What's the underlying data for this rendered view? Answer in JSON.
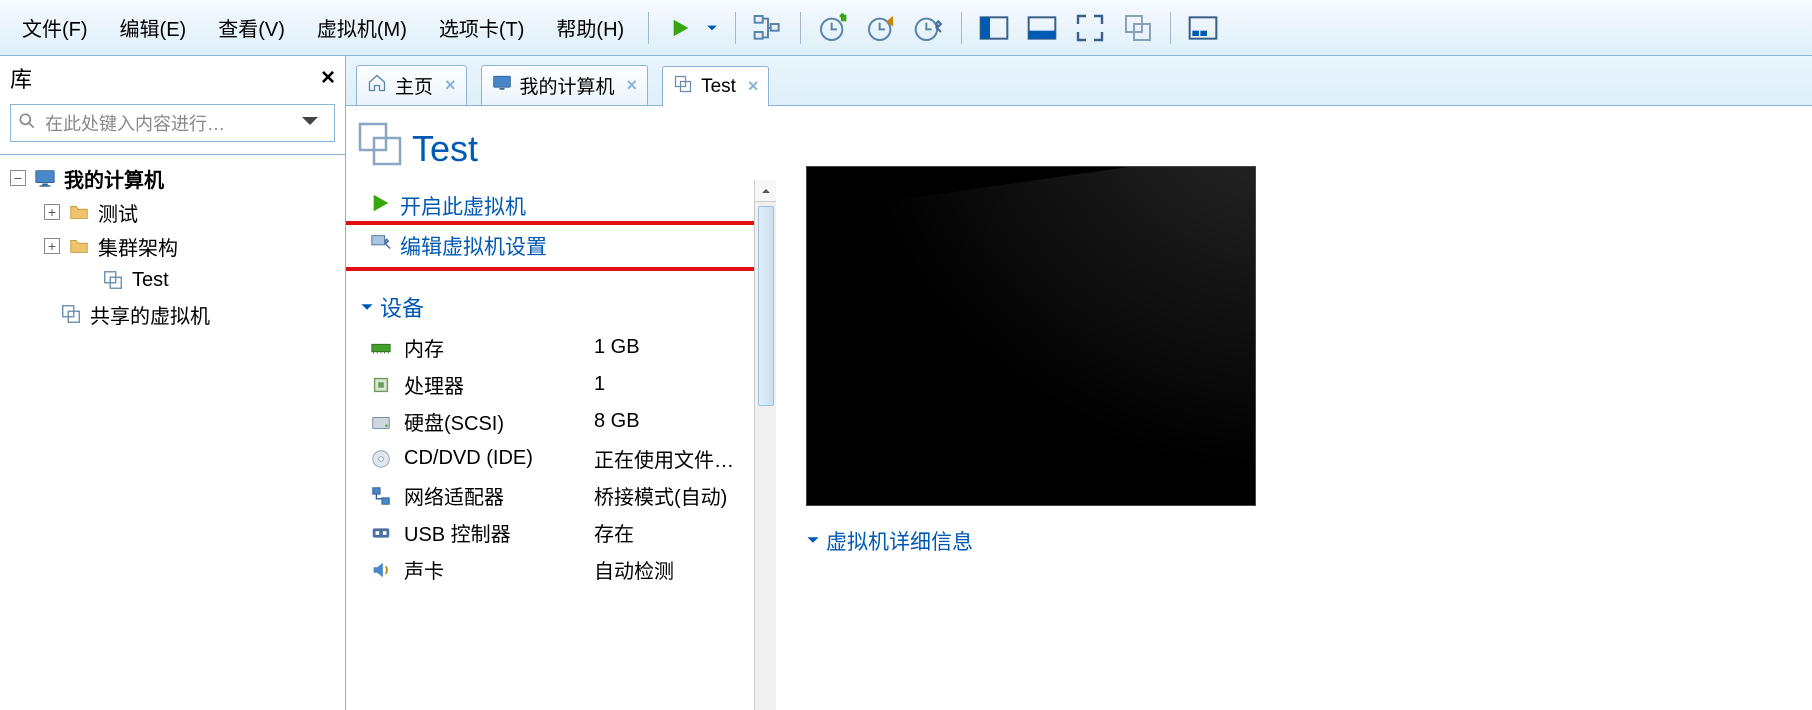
{
  "menu": {
    "file": "文件(F)",
    "edit": "编辑(E)",
    "view": "查看(V)",
    "vm": "虚拟机(M)",
    "tabs": "选项卡(T)",
    "help": "帮助(H)"
  },
  "sidebar": {
    "title": "库",
    "search_placeholder": "在此处键入内容进行…",
    "tree": {
      "my_computer": "我的计算机",
      "test_folder": "测试",
      "cluster_folder": "集群架构",
      "test_vm": "Test",
      "shared": "共享的虚拟机"
    }
  },
  "tabs": {
    "home": "主页",
    "my_computer": "我的计算机",
    "test": "Test"
  },
  "vm": {
    "title": "Test",
    "actions": {
      "power_on": "开启此虚拟机",
      "edit_settings": "编辑虚拟机设置"
    },
    "section_devices": "设备",
    "devices": [
      {
        "name": "内存",
        "value": "1 GB",
        "icon": "memory"
      },
      {
        "name": "处理器",
        "value": "1",
        "icon": "cpu"
      },
      {
        "name": "硬盘(SCSI)",
        "value": "8 GB",
        "icon": "hdd"
      },
      {
        "name": "CD/DVD (IDE)",
        "value": "正在使用文件…",
        "icon": "cd"
      },
      {
        "name": "网络适配器",
        "value": "桥接模式(自动)",
        "icon": "network"
      },
      {
        "name": "USB 控制器",
        "value": "存在",
        "icon": "usb"
      },
      {
        "name": "声卡",
        "value": "自动检测",
        "icon": "sound"
      }
    ],
    "details_caption": "虚拟机详细信息"
  }
}
